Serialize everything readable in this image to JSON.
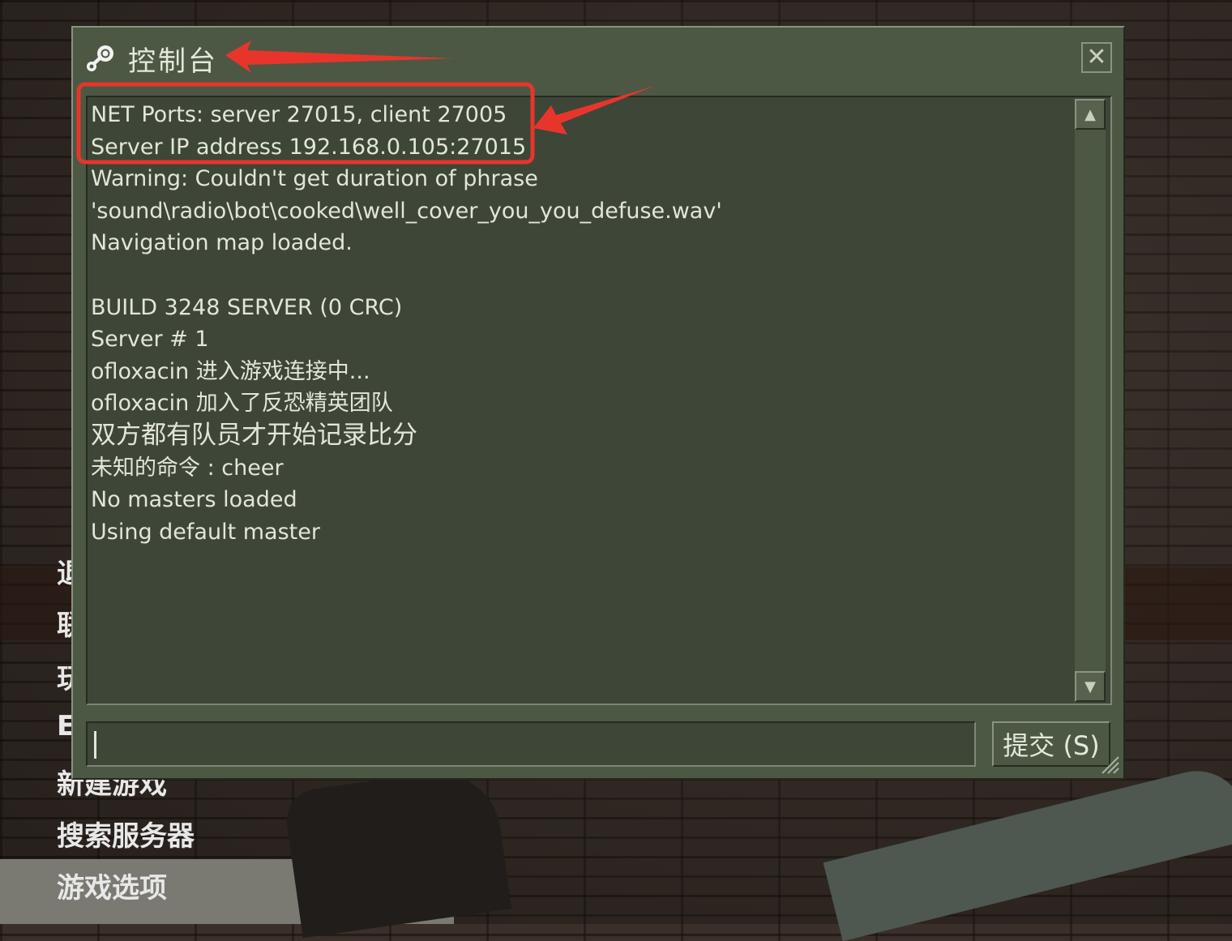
{
  "menu": {
    "items": [
      "退",
      "联",
      "玩",
      "E",
      "新建游戏",
      "搜索服务器",
      "游戏选项"
    ]
  },
  "console": {
    "title": "控制台",
    "close_label": "✕",
    "lines": [
      "NET Ports:  server 27015, client 27005",
      "Server IP address 192.168.0.105:27015",
      "Warning: Couldn't get duration of phrase",
      "'sound\\radio\\bot\\cooked\\well_cover_you_you_defuse.wav'",
      "Navigation map loaded.",
      "",
      "BUILD 3248 SERVER (0 CRC)",
      "Server # 1",
      "ofloxacin 进入游戏连接中...",
      "ofloxacin 加入了反恐精英团队",
      "双方都有队员才开始记录比分",
      "未知的命令 : cheer",
      "No masters loaded",
      "Using default master"
    ],
    "input_value": "",
    "submit_label": "提交 (S)"
  },
  "icons": {
    "title_icon": "steam-icon",
    "scroll_up": "arrow-up-icon",
    "scroll_down": "arrow-down-icon",
    "resize": "resize-grip-icon"
  },
  "colors": {
    "panel": "#4c5844",
    "text_area": "#3e4637",
    "text": "#e2e6d8",
    "annotation": "#e8352c"
  }
}
